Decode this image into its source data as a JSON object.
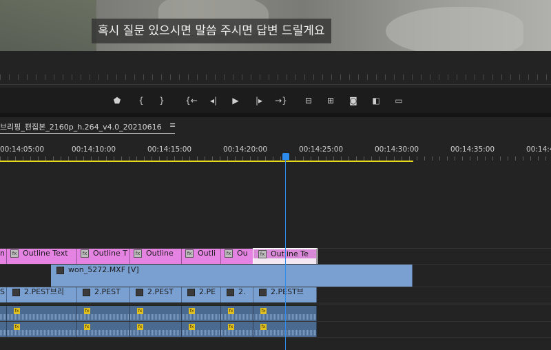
{
  "preview": {
    "subtitle": "혹시 질문 있으시면 말씀 주시면 답변 드릴게요"
  },
  "transport": {
    "buttons": [
      {
        "name": "add-marker-button",
        "icon": "marker-icon",
        "glyph": "⬟"
      },
      {
        "name": "mark-in-button",
        "icon": "mark-in-icon",
        "glyph": "{"
      },
      {
        "name": "mark-out-button",
        "icon": "mark-out-icon",
        "glyph": "}"
      },
      {
        "name": "go-to-in-button",
        "icon": "go-to-in-icon",
        "glyph": "{←"
      },
      {
        "name": "step-back-button",
        "icon": "step-back-icon",
        "glyph": "◂|"
      },
      {
        "name": "play-button",
        "icon": "play-icon",
        "glyph": "▶"
      },
      {
        "name": "step-forward-button",
        "icon": "step-forward-icon",
        "glyph": "|▸"
      },
      {
        "name": "go-to-out-button",
        "icon": "go-to-out-icon",
        "glyph": "→}"
      },
      {
        "name": "lift-button",
        "icon": "lift-icon",
        "glyph": "⊟"
      },
      {
        "name": "extract-button",
        "icon": "extract-icon",
        "glyph": "⊞"
      },
      {
        "name": "export-frame-button",
        "icon": "camera-icon",
        "glyph": "◙"
      },
      {
        "name": "comparison-view-button",
        "icon": "comparison-icon",
        "glyph": "◧"
      },
      {
        "name": "safe-margins-button",
        "icon": "safe-margins-icon",
        "glyph": "▭"
      }
    ]
  },
  "timeline": {
    "sequence_name": "브리핑_편집본_2160p_h.264_v4.0_20210616",
    "menu_glyph": "≡",
    "timecodes": [
      "00:14:05:00",
      "00:14:10:00",
      "00:14:15:00",
      "00:14:20:00",
      "00:14:25:00",
      "00:14:30:00",
      "00:14:35:00",
      "00:14:4"
    ],
    "graphics_clips": [
      "n",
      "Outline Text",
      "Outline T",
      "Outline",
      "Outli",
      "Ou",
      "Outline Te"
    ],
    "video_clip": "won_5272.MXF [V]",
    "v1_clips": [
      "S",
      "2.PEST브리",
      "2.PEST",
      "2.PEST",
      "2.PE",
      "2.",
      "2.PEST브"
    ],
    "fx_label": "fx"
  },
  "colors": {
    "graphics_clip": "#e483e2",
    "video_clip": "#7a9fd1",
    "audio_clip": "#4a6a90",
    "playhead": "#2d8ceb",
    "work_area": "#e8d81c"
  }
}
